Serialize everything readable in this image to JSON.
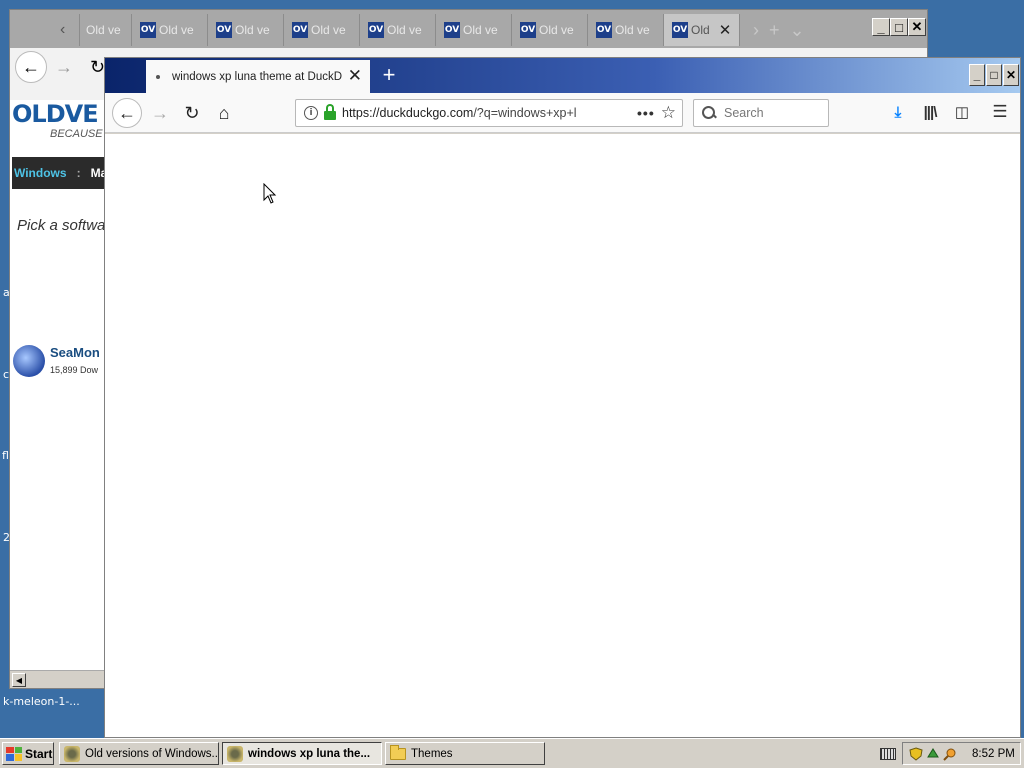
{
  "desktop": {
    "labels": [
      "a",
      "c",
      "fl",
      "2",
      "k-meleon-1-..."
    ]
  },
  "background_window": {
    "tabs": [
      "Old ve",
      "Old ve",
      "Old ve",
      "Old ve",
      "Old ve",
      "Old ve",
      "Old ve",
      "Old ve",
      "Old"
    ],
    "tab_icon_text": "OV",
    "page": {
      "logo": "OLDVE",
      "tagline": "BECAUSE",
      "nav": [
        "Windows",
        ":",
        "Ma"
      ],
      "pick_text": "Pick a softwa",
      "app_name": "SeaMon",
      "app_downloads": "15,899 Dow"
    }
  },
  "foreground_window": {
    "tab_title": "windows xp luna theme at DuckDu",
    "url_domain": "https://duckduckgo.com",
    "url_path": "/?q=windows+xp+l",
    "search_placeholder": "Search"
  },
  "taskbar": {
    "start_label": "Start",
    "tasks": [
      {
        "label": "Old versions of Windows...",
        "active": false
      },
      {
        "label": "windows xp luna the...",
        "active": true
      },
      {
        "label": "Themes",
        "active": false
      }
    ],
    "clock": "8:52 PM"
  },
  "colors": {
    "desktop": "#3a6ea5",
    "titlebar_start": "#0a246a",
    "titlebar_end": "#a6caf0",
    "ov_blue": "#1a5aa0",
    "nav_windows": "#4ec3e6"
  }
}
